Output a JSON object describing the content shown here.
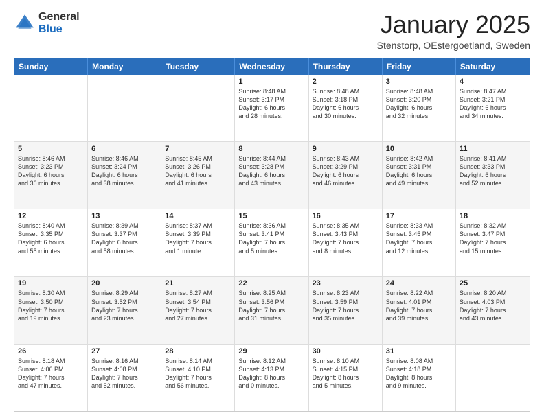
{
  "logo": {
    "general": "General",
    "blue": "Blue"
  },
  "header": {
    "title": "January 2025",
    "location": "Stenstorp, OEstergoetland, Sweden"
  },
  "weekdays": [
    "Sunday",
    "Monday",
    "Tuesday",
    "Wednesday",
    "Thursday",
    "Friday",
    "Saturday"
  ],
  "rows": [
    [
      {
        "day": "",
        "text": ""
      },
      {
        "day": "",
        "text": ""
      },
      {
        "day": "",
        "text": ""
      },
      {
        "day": "1",
        "text": "Sunrise: 8:48 AM\nSunset: 3:17 PM\nDaylight: 6 hours\nand 28 minutes."
      },
      {
        "day": "2",
        "text": "Sunrise: 8:48 AM\nSunset: 3:18 PM\nDaylight: 6 hours\nand 30 minutes."
      },
      {
        "day": "3",
        "text": "Sunrise: 8:48 AM\nSunset: 3:20 PM\nDaylight: 6 hours\nand 32 minutes."
      },
      {
        "day": "4",
        "text": "Sunrise: 8:47 AM\nSunset: 3:21 PM\nDaylight: 6 hours\nand 34 minutes."
      }
    ],
    [
      {
        "day": "5",
        "text": "Sunrise: 8:46 AM\nSunset: 3:23 PM\nDaylight: 6 hours\nand 36 minutes."
      },
      {
        "day": "6",
        "text": "Sunrise: 8:46 AM\nSunset: 3:24 PM\nDaylight: 6 hours\nand 38 minutes."
      },
      {
        "day": "7",
        "text": "Sunrise: 8:45 AM\nSunset: 3:26 PM\nDaylight: 6 hours\nand 41 minutes."
      },
      {
        "day": "8",
        "text": "Sunrise: 8:44 AM\nSunset: 3:28 PM\nDaylight: 6 hours\nand 43 minutes."
      },
      {
        "day": "9",
        "text": "Sunrise: 8:43 AM\nSunset: 3:29 PM\nDaylight: 6 hours\nand 46 minutes."
      },
      {
        "day": "10",
        "text": "Sunrise: 8:42 AM\nSunset: 3:31 PM\nDaylight: 6 hours\nand 49 minutes."
      },
      {
        "day": "11",
        "text": "Sunrise: 8:41 AM\nSunset: 3:33 PM\nDaylight: 6 hours\nand 52 minutes."
      }
    ],
    [
      {
        "day": "12",
        "text": "Sunrise: 8:40 AM\nSunset: 3:35 PM\nDaylight: 6 hours\nand 55 minutes."
      },
      {
        "day": "13",
        "text": "Sunrise: 8:39 AM\nSunset: 3:37 PM\nDaylight: 6 hours\nand 58 minutes."
      },
      {
        "day": "14",
        "text": "Sunrise: 8:37 AM\nSunset: 3:39 PM\nDaylight: 7 hours\nand 1 minute."
      },
      {
        "day": "15",
        "text": "Sunrise: 8:36 AM\nSunset: 3:41 PM\nDaylight: 7 hours\nand 5 minutes."
      },
      {
        "day": "16",
        "text": "Sunrise: 8:35 AM\nSunset: 3:43 PM\nDaylight: 7 hours\nand 8 minutes."
      },
      {
        "day": "17",
        "text": "Sunrise: 8:33 AM\nSunset: 3:45 PM\nDaylight: 7 hours\nand 12 minutes."
      },
      {
        "day": "18",
        "text": "Sunrise: 8:32 AM\nSunset: 3:47 PM\nDaylight: 7 hours\nand 15 minutes."
      }
    ],
    [
      {
        "day": "19",
        "text": "Sunrise: 8:30 AM\nSunset: 3:50 PM\nDaylight: 7 hours\nand 19 minutes."
      },
      {
        "day": "20",
        "text": "Sunrise: 8:29 AM\nSunset: 3:52 PM\nDaylight: 7 hours\nand 23 minutes."
      },
      {
        "day": "21",
        "text": "Sunrise: 8:27 AM\nSunset: 3:54 PM\nDaylight: 7 hours\nand 27 minutes."
      },
      {
        "day": "22",
        "text": "Sunrise: 8:25 AM\nSunset: 3:56 PM\nDaylight: 7 hours\nand 31 minutes."
      },
      {
        "day": "23",
        "text": "Sunrise: 8:23 AM\nSunset: 3:59 PM\nDaylight: 7 hours\nand 35 minutes."
      },
      {
        "day": "24",
        "text": "Sunrise: 8:22 AM\nSunset: 4:01 PM\nDaylight: 7 hours\nand 39 minutes."
      },
      {
        "day": "25",
        "text": "Sunrise: 8:20 AM\nSunset: 4:03 PM\nDaylight: 7 hours\nand 43 minutes."
      }
    ],
    [
      {
        "day": "26",
        "text": "Sunrise: 8:18 AM\nSunset: 4:06 PM\nDaylight: 7 hours\nand 47 minutes."
      },
      {
        "day": "27",
        "text": "Sunrise: 8:16 AM\nSunset: 4:08 PM\nDaylight: 7 hours\nand 52 minutes."
      },
      {
        "day": "28",
        "text": "Sunrise: 8:14 AM\nSunset: 4:10 PM\nDaylight: 7 hours\nand 56 minutes."
      },
      {
        "day": "29",
        "text": "Sunrise: 8:12 AM\nSunset: 4:13 PM\nDaylight: 8 hours\nand 0 minutes."
      },
      {
        "day": "30",
        "text": "Sunrise: 8:10 AM\nSunset: 4:15 PM\nDaylight: 8 hours\nand 5 minutes."
      },
      {
        "day": "31",
        "text": "Sunrise: 8:08 AM\nSunset: 4:18 PM\nDaylight: 8 hours\nand 9 minutes."
      },
      {
        "day": "",
        "text": ""
      }
    ]
  ]
}
